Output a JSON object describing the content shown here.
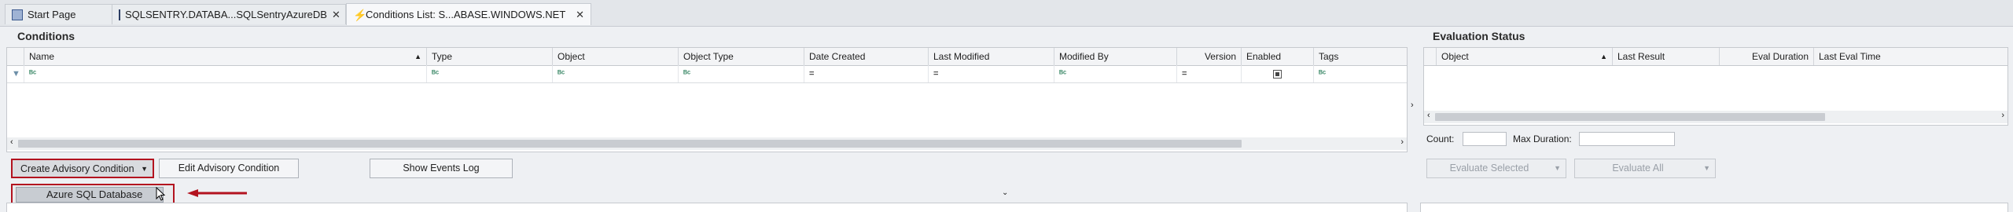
{
  "tabs": [
    {
      "label": "Start Page",
      "icon": "page-icon"
    },
    {
      "label": "SQLSENTRY.DATABA...SQLSentryAzureDB",
      "icon": "database-icon"
    },
    {
      "label": "Conditions List: S...ABASE.WINDOWS.NET",
      "icon": "lightning-icon",
      "active": true
    }
  ],
  "conditions": {
    "title": "Conditions",
    "columns": [
      "Name",
      "Type",
      "Object",
      "Object Type",
      "Date Created",
      "Last Modified",
      "Modified By",
      "Version",
      "Enabled",
      "Tags"
    ],
    "filter_marks": {
      "text": "ᴮᶜ",
      "equals": "="
    },
    "buttons": {
      "create": "Create Advisory Condition",
      "edit": "Edit Advisory Condition",
      "show_events": "Show Events Log"
    },
    "dropdown_item": "Azure SQL Database"
  },
  "evaluation": {
    "title": "Evaluation Status",
    "columns": [
      "Object",
      "Last Result",
      "Eval Duration",
      "Last Eval Time"
    ],
    "count_label": "Count:",
    "max_duration_label": "Max Duration:",
    "count_value": "",
    "max_duration_value": "",
    "evaluate_selected": "Evaluate Selected",
    "evaluate_all": "Evaluate All"
  },
  "colors": {
    "highlight": "#b3131f",
    "accent": "#3e8a6a"
  }
}
